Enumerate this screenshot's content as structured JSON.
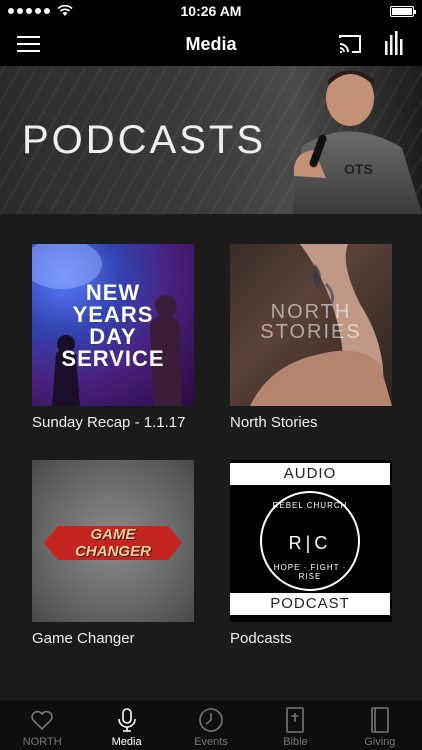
{
  "status": {
    "time": "10:26 AM"
  },
  "nav": {
    "title": "Media"
  },
  "hero": {
    "title": "PODCASTS"
  },
  "cards": [
    {
      "label": "Sunday Recap - 1.1.17",
      "thumb_text": [
        "NEW",
        "YEARS",
        "DAY",
        "SERVICE"
      ]
    },
    {
      "label": "North Stories",
      "thumb_text": [
        "NORTH",
        "STORIES"
      ]
    },
    {
      "label": "Game Changer",
      "thumb_text": [
        "GAME",
        "CHANGER"
      ]
    },
    {
      "label": "Podcasts",
      "thumb_top": "AUDIO",
      "thumb_bottom": "PODCAST",
      "logo": "R|C",
      "logo_top": "REBEL CHURCH",
      "logo_bottom": "HOPE · FIGHT · RISE"
    }
  ],
  "tabs": [
    {
      "label": "NORTH",
      "icon": "heart-icon",
      "active": false
    },
    {
      "label": "Media",
      "icon": "microphone-icon",
      "active": true
    },
    {
      "label": "Events",
      "icon": "clock-icon",
      "active": false
    },
    {
      "label": "Bible",
      "icon": "bible-icon",
      "active": false
    },
    {
      "label": "Giving",
      "icon": "book-icon",
      "active": false
    }
  ],
  "colors": {
    "background": "#1b1b1b",
    "bar": "#000000",
    "tab_inactive": "#777777",
    "accent_red": "#c42520"
  }
}
